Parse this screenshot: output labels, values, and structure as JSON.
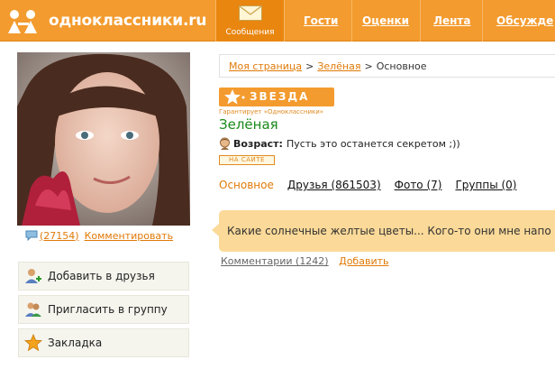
{
  "header": {
    "logo_text": "одноклассники.ru",
    "messages_label": "Сообщения",
    "nav": [
      "Гости",
      "Оценки",
      "Лента",
      "Обсужде"
    ]
  },
  "profile": {
    "photo_comments_count": "(27154)",
    "photo_comment_link": "Комментировать",
    "actions": [
      "Добавить в друзья",
      "Пригласить в группу",
      "Закладка"
    ]
  },
  "breadcrumb": {
    "items": [
      "Моя страница",
      "Зелёная",
      "Основное"
    ],
    "separator": ">"
  },
  "star": {
    "badge": "ЗВЕЗДА",
    "subtitle": "Гарантирует «Одноклассники»"
  },
  "user": {
    "name": "Зелёная",
    "age_label": "Возраст:",
    "age_value": "Пусть это останется секретом ;))",
    "online_badge": "НА САЙТЕ"
  },
  "tabs": [
    "Основное",
    "Друзья (861503)",
    "Фото (7)",
    "Группы (0)"
  ],
  "status": {
    "text": "Какие солнечные желтые цветы... Кого-то они мне напо",
    "comments_link": "Комментарии (1242)",
    "add_link": "Добавить"
  },
  "colors": {
    "brand_orange": "#f39b2e",
    "link_orange": "#e07a08",
    "name_green": "#1a8a1a",
    "status_bg": "#fbd998"
  }
}
